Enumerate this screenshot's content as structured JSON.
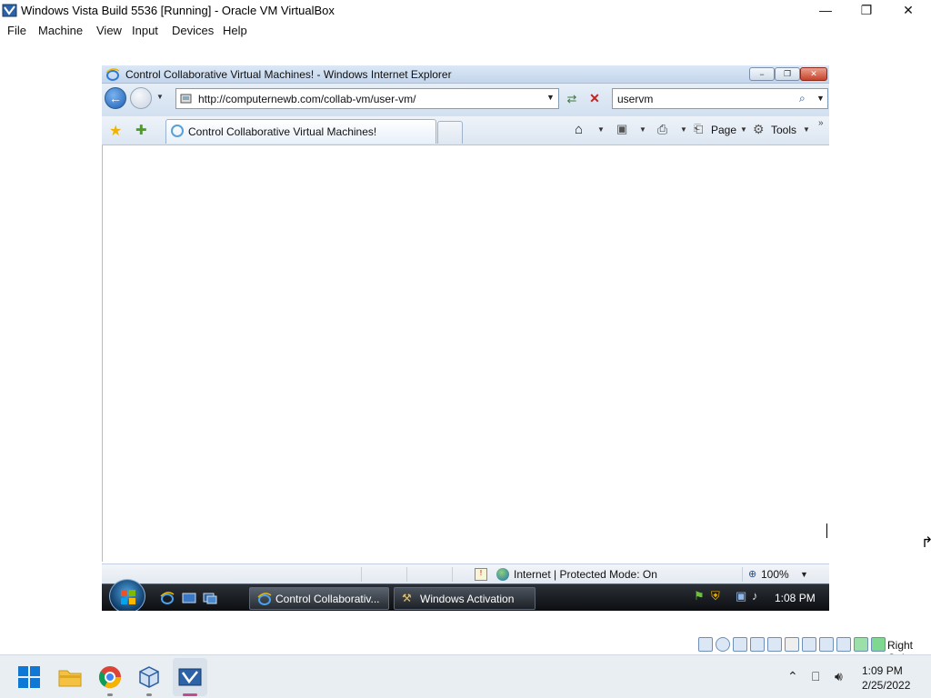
{
  "host": {
    "window_title": "Windows Vista Build 5536 [Running] - Oracle VM VirtualBox",
    "menu": [
      "File",
      "Machine",
      "View",
      "Input",
      "Devices",
      "Help"
    ],
    "host_key_label": "Right Ctrl",
    "clock_time": "1:09 PM",
    "clock_date": "2/25/2022"
  },
  "ie": {
    "window_title": "Control Collaborative Virtual Machines! - Windows Internet Explorer",
    "address": "http://computernewb.com/collab-vm/user-vm/",
    "search_value": "uservm",
    "tab_label": "Control Collaborative Virtual Machines!",
    "cmd_page": "Page",
    "cmd_tools": "Tools",
    "status_zone": "Internet | Protected Mode: On",
    "zoom": "100%"
  },
  "vista": {
    "task_buttons": [
      "Control Collaborativ...",
      "Windows Activation"
    ],
    "clock": "1:08 PM"
  },
  "colors": {
    "vista_taskbar": "#1b1f24",
    "ie_chrome": "#d2e0f0",
    "host_taskbar": "#e9eef3"
  }
}
